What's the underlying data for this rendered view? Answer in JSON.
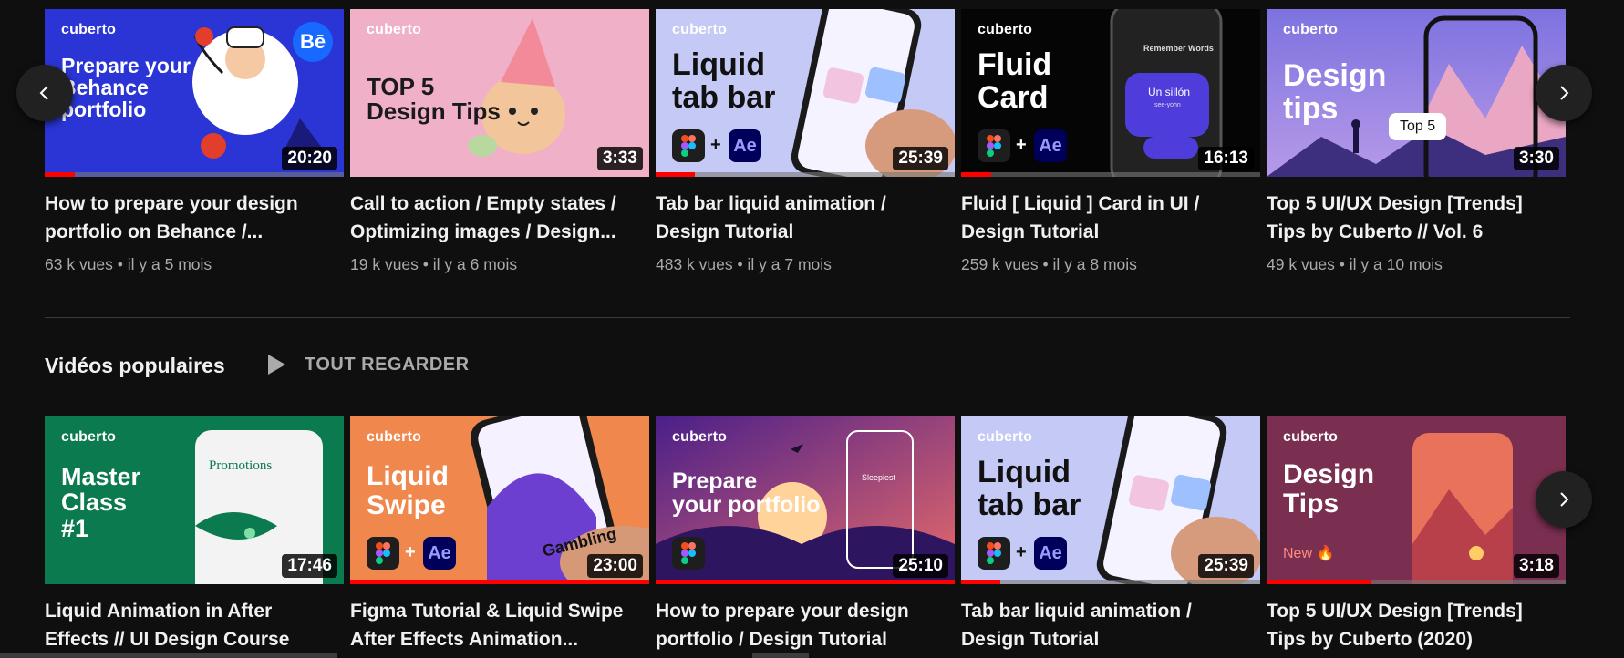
{
  "row1": [
    {
      "brand": "cuberto",
      "headline": "Prepare your\nBehance\nportfolio",
      "duration": "20:20",
      "progress": 0.1,
      "title": "How to prepare your design portfolio on Behance /...",
      "views": "63 k vues",
      "age": "il y a 5 mois",
      "bg": "#2b35d6",
      "badge": "Bē"
    },
    {
      "brand": "cuberto",
      "headline": "TOP 5\nDesign Tips",
      "duration": "3:33",
      "progress": 0,
      "title": "Call to action / Empty states / Optimizing images / Design...",
      "views": "19 k vues",
      "age": "il y a 6 mois",
      "bg": "#efb0c8"
    },
    {
      "brand": "cuberto",
      "headline": "Liquid\ntab bar",
      "duration": "25:39",
      "progress": 0.13,
      "title": "Tab bar liquid animation / Design Tutorial",
      "views": "483 k vues",
      "age": "il y a 7 mois",
      "bg": "#c5c9f5",
      "apps": [
        "Figma",
        "Ae"
      ]
    },
    {
      "brand": "cuberto",
      "headline": "Fluid\nCard",
      "duration": "16:13",
      "progress": 0.1,
      "title": "Fluid [ Liquid ] Card in UI / Design Tutorial",
      "views": "259 k vues",
      "age": "il y a 8 mois",
      "bg": "#050505",
      "apps": [
        "Figma",
        "Ae"
      ],
      "phone_caption": "Remember Words",
      "phone_word": "Un sillón",
      "phone_sub": "see-yohn"
    },
    {
      "brand": "cuberto",
      "headline": "Design\ntips",
      "duration": "3:30",
      "progress": 0,
      "title": "Top 5 UI/UX Design [Trends] Tips by Cuberto // Vol. 6",
      "views": "49 k vues",
      "age": "il y a 10 mois",
      "bg": "#8b7ed9",
      "pill": "Top 5"
    }
  ],
  "section": {
    "title": "Vidéos populaires",
    "play_all": "TOUT REGARDER"
  },
  "row2": [
    {
      "brand": "cuberto",
      "headline": "Master\nClass\n#1",
      "duration": "17:46",
      "progress": 0,
      "title": "Liquid Animation in After Effects // UI Design Course",
      "bg": "#0b7a4e",
      "screen_title": "Promotions"
    },
    {
      "brand": "cuberto",
      "headline": "Liquid\nSwipe",
      "duration": "23:00",
      "progress": 1,
      "title": "Figma Tutorial & Liquid Swipe After Effects Animation...",
      "bg": "#f0884e",
      "apps": [
        "Figma",
        "Ae"
      ],
      "phone_text": "Gambling"
    },
    {
      "brand": "cuberto",
      "headline": "Prepare\nyour portfolio",
      "duration": "25:10",
      "progress": 1,
      "title": "How to prepare your design portfolio / Design Tutorial",
      "bg": "#5b2a8a",
      "apps": [
        "Figma"
      ],
      "phone_text": "Sleepiest"
    },
    {
      "brand": "cuberto",
      "headline": "Liquid\ntab bar",
      "duration": "25:39",
      "progress": 0.13,
      "title": "Tab bar liquid animation / Design Tutorial",
      "bg": "#c5c9f5",
      "apps": [
        "Figma",
        "Ae"
      ]
    },
    {
      "brand": "cuberto",
      "headline": "Design\nTips",
      "duration": "3:18",
      "progress": 0.35,
      "title": "Top 5 UI/UX Design [Trends] Tips by Cuberto (2020)",
      "bg": "#7a2f50",
      "tag": "New 🔥"
    }
  ],
  "icons": {
    "prev": "chevron-left-icon",
    "next": "chevron-right-icon",
    "play": "play-icon"
  },
  "colors": {
    "accent": "#ff0000",
    "background": "#0f0f0f",
    "meta": "#aaaaaa"
  }
}
